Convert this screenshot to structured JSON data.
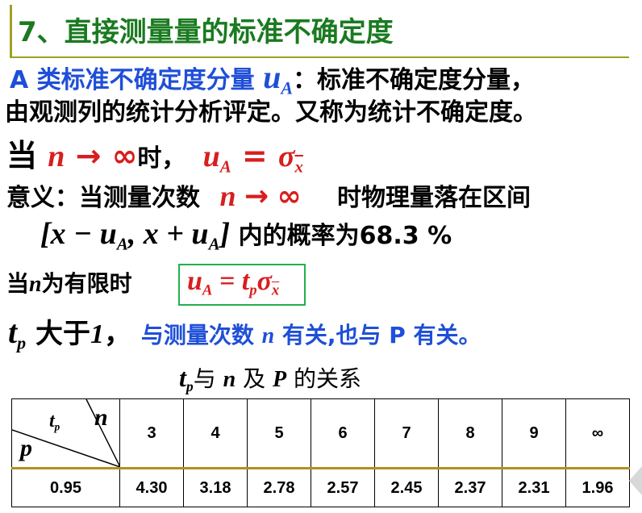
{
  "title": "7、直接测量量的标准不确定度",
  "line1": {
    "prefix": "A 类标准不确定度分量",
    "sym": "u",
    "sub": "A",
    "suffix": "：标准不确定度分量，"
  },
  "line2": "由观测列的统计分析评定。又称为统计不确定度。",
  "line3": {
    "when": "当",
    "n": "n",
    "arrow": "→",
    "inf": "∞",
    "time": "时，",
    "u": "u",
    "sub": "A",
    "eq": "=",
    "sigma": "σ",
    "xbar": "x"
  },
  "line4": {
    "meaning": "意义：当测量次数",
    "n": "n",
    "arrow": "→",
    "inf": "∞",
    "rest": "时物理量落在区间"
  },
  "line5": {
    "interval": "[x − u",
    "sub1": "A",
    "mid": ", x + u",
    "sub2": "A",
    "close": "]",
    "rest": "内的概率为68.3 %"
  },
  "line6": {
    "text_when": "当",
    "n": "n",
    "text_finite": "为有限时",
    "u": "u",
    "sub": "A",
    "eq": " = ",
    "t": "t",
    "tsub": "p",
    "sigma": "σ",
    "xbar": "x"
  },
  "line7": {
    "t": "t",
    "tsub": "p",
    "greater": " 大于",
    "one": "1",
    "comma": "，",
    "blue_text1": "与测量次数 ",
    "n": "n",
    "blue_text2": " 有关,也与 P 有关。"
  },
  "table_caption": {
    "t": "t",
    "tsub": "p",
    "text1": "与 ",
    "n": "n",
    "text2": " 及 ",
    "P": "P",
    "text3": " 的关系"
  },
  "table": {
    "corner": {
      "tp": "t",
      "tp_sub": "p",
      "n": "n",
      "p": "p"
    },
    "headers": [
      "3",
      "4",
      "5",
      "6",
      "7",
      "8",
      "9",
      "∞"
    ],
    "rows": [
      {
        "p": "0.95",
        "values": [
          "4.30",
          "3.18",
          "2.78",
          "2.57",
          "2.45",
          "2.37",
          "2.31",
          "1.96"
        ]
      }
    ]
  },
  "colors": {
    "title": "#1a7a20",
    "red": "#d81e1e",
    "blue": "#1f4fd8",
    "box": "#22b14c",
    "rule": "#a0a020"
  }
}
